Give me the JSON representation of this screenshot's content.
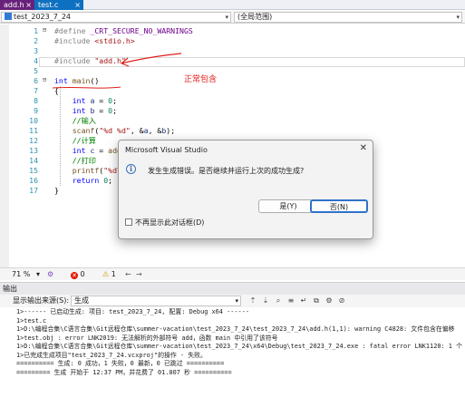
{
  "tabs": [
    {
      "label": "add.h",
      "close": "×"
    },
    {
      "label": "test.c",
      "close": "×"
    }
  ],
  "navbar": {
    "project": "test_2023_7_24",
    "scope": "(全局范围)"
  },
  "editor": {
    "lines": [
      {
        "no": "1",
        "parts": [
          [
            "pp",
            "#define "
          ],
          [
            "mac",
            "_CRT_SECURE_NO_WARNINGS"
          ]
        ]
      },
      {
        "no": "2",
        "parts": [
          [
            "pp",
            "#include "
          ],
          [
            "str",
            "<stdio.h>"
          ]
        ]
      },
      {
        "no": "3",
        "parts": []
      },
      {
        "no": "4",
        "parts": [
          [
            "pp",
            "#include "
          ],
          [
            "str",
            "\"add.h\""
          ]
        ]
      },
      {
        "no": "5",
        "parts": []
      },
      {
        "no": "6",
        "parts": [
          [
            "kw",
            "int "
          ],
          [
            "fn",
            "main"
          ],
          [
            "",
            "()"
          ]
        ]
      },
      {
        "no": "7",
        "parts": [
          [
            "",
            "{"
          ]
        ]
      },
      {
        "no": "8",
        "parts": [
          [
            "",
            "    "
          ],
          [
            "kw",
            "int "
          ],
          [
            "var",
            "a"
          ],
          [
            "",
            " = "
          ],
          [
            "num",
            "0"
          ],
          [
            "",
            ";"
          ]
        ]
      },
      {
        "no": "9",
        "parts": [
          [
            "",
            "    "
          ],
          [
            "kw",
            "int "
          ],
          [
            "var",
            "b"
          ],
          [
            "",
            " = "
          ],
          [
            "num",
            "0"
          ],
          [
            "",
            ";"
          ]
        ]
      },
      {
        "no": "10",
        "parts": [
          [
            "",
            "    "
          ],
          [
            "cm",
            "//输入"
          ]
        ]
      },
      {
        "no": "11",
        "parts": [
          [
            "",
            "    "
          ],
          [
            "fn",
            "scanf"
          ],
          [
            "",
            "("
          ],
          [
            "str",
            "\"%d %d\""
          ],
          [
            "",
            ", &"
          ],
          [
            "var",
            "a"
          ],
          [
            "",
            ", &"
          ],
          [
            "var",
            "b"
          ],
          [
            "",
            ");"
          ]
        ]
      },
      {
        "no": "12",
        "parts": [
          [
            "",
            "    "
          ],
          [
            "cm",
            "//计算"
          ]
        ]
      },
      {
        "no": "13",
        "parts": [
          [
            "",
            "    "
          ],
          [
            "kw",
            "int "
          ],
          [
            "var",
            "c"
          ],
          [
            "",
            " = "
          ],
          [
            "fn",
            "add"
          ],
          [
            "",
            "("
          ]
        ]
      },
      {
        "no": "14",
        "parts": [
          [
            "",
            "    "
          ],
          [
            "cm",
            "//打印"
          ]
        ]
      },
      {
        "no": "15",
        "parts": [
          [
            "",
            "    "
          ],
          [
            "fn",
            "printf"
          ],
          [
            "",
            "("
          ],
          [
            "str",
            "\"%d\\n"
          ]
        ]
      },
      {
        "no": "16",
        "parts": [
          [
            "",
            "    "
          ],
          [
            "kw",
            "return "
          ],
          [
            "num",
            "0"
          ],
          [
            "",
            ";"
          ]
        ]
      },
      {
        "no": "17",
        "parts": [
          [
            "",
            "}"
          ]
        ]
      }
    ]
  },
  "annotation": "正常包含",
  "statusbar": {
    "zoom": "71 %",
    "errors": "0",
    "warnings": "1"
  },
  "output": {
    "title": "输出",
    "source_label": "显示输出来源(S):",
    "source_value": "生成",
    "lines": [
      "1>------ 已启动生成: 项目: test_2023_7_24, 配置: Debug x64 ------",
      "1>test.c",
      "1>D:\\编程合集\\C语言合集\\Git远程仓库\\summer-vacation\\test_2023_7_24\\test_2023_7_24\\add.h(1,1): warning C4828: 文件包含在偏移",
      "1>test.obj : error LNK2019: 无法解析的外部符号 add，函数 main 中引用了该符号",
      "1>D:\\编程合集\\C语言合集\\Git远程仓库\\summer-vacation\\test_2023_7_24\\x64\\Debug\\test_2023_7_24.exe : fatal error LNK1120: 1 个",
      "1>已完成生成项目\"test_2023_7_24.vcxproj\"的操作 - 失败。",
      "========== 生成: 0 成功，1 失败，0 最新，0 已跳过 ==========",
      "========= 生成 开始于 12:37 PM，并花费了 01.807 秒 =========="
    ]
  },
  "dialog": {
    "title": "Microsoft Visual Studio",
    "close": "✕",
    "message": "发生生成错误。是否继续并运行上次的成功生成?",
    "yes": "是(Y)",
    "no": "否(N)",
    "checkbox_label": "不再显示此对话框(D)"
  },
  "colors": {
    "annotation_red": "#e0201d",
    "error_red": "#e51400",
    "accent_blue": "#0e70c0"
  }
}
